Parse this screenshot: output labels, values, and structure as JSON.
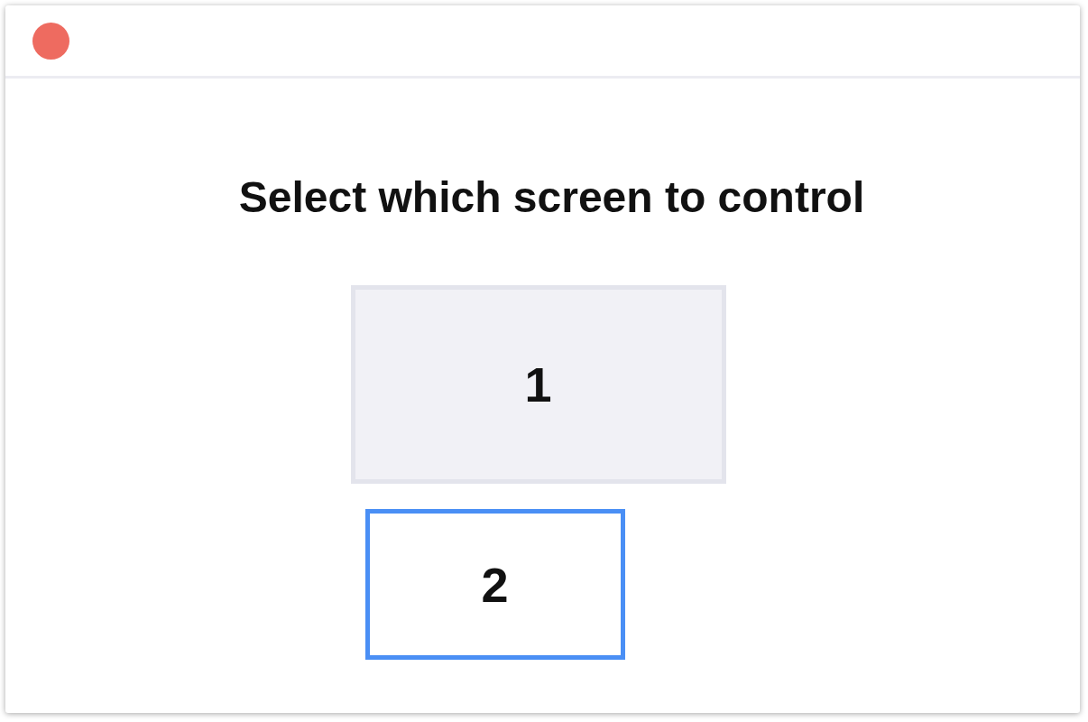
{
  "window": {
    "close_button": true
  },
  "heading": "Select which screen to control",
  "screens": [
    {
      "label": "1",
      "selected": false
    },
    {
      "label": "2",
      "selected": true
    }
  ]
}
